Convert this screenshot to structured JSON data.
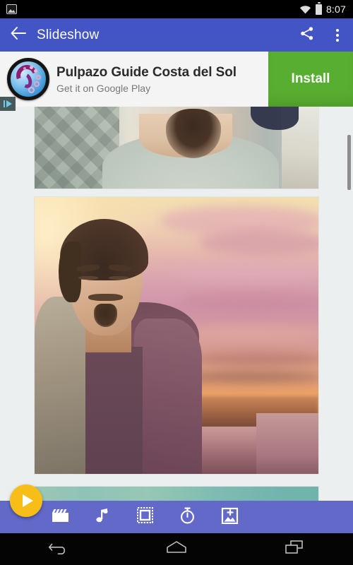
{
  "statusbar": {
    "notification_icon": "photo-notification-icon",
    "wifi_icon": "wifi-icon",
    "battery_icon": "battery-icon",
    "clock": "8:07"
  },
  "appbar": {
    "back_icon": "back-arrow-icon",
    "title": "Slideshow",
    "share_icon": "share-icon",
    "overflow_icon": "overflow-menu-icon",
    "background_color": "#4355c4"
  },
  "ad": {
    "app_icon": "pulpazo-app-icon",
    "title": "Pulpazo Guide Costa del Sol",
    "subtitle": "Get it on Google Play",
    "install_label": "Install",
    "install_color": "#58ae30",
    "adchoices_icon": "adchoices-icon"
  },
  "content": {
    "photos": [
      {
        "name": "photo-thumbnail-1",
        "alt": "close-up of man's chin and beard"
      },
      {
        "name": "photo-thumbnail-2",
        "alt": "man standing in front of sunset sky"
      },
      {
        "name": "photo-thumbnail-3",
        "alt": "teal toned photo"
      }
    ],
    "scrollbar": "vertical-scrollbar"
  },
  "fab": {
    "icon": "play-icon",
    "color": "#f8be18",
    "label": "Play slideshow"
  },
  "toolbar": {
    "background_color": "#6269c8",
    "items": [
      {
        "name": "movie-icon",
        "label": "Movie"
      },
      {
        "name": "music-note-icon",
        "label": "Music"
      },
      {
        "name": "frame-icon",
        "label": "Frame"
      },
      {
        "name": "timer-icon",
        "label": "Timer"
      },
      {
        "name": "add-photo-icon",
        "label": "Add photo"
      }
    ]
  },
  "navbar": {
    "back_label": "Back",
    "home_label": "Home",
    "recents_label": "Recents"
  }
}
